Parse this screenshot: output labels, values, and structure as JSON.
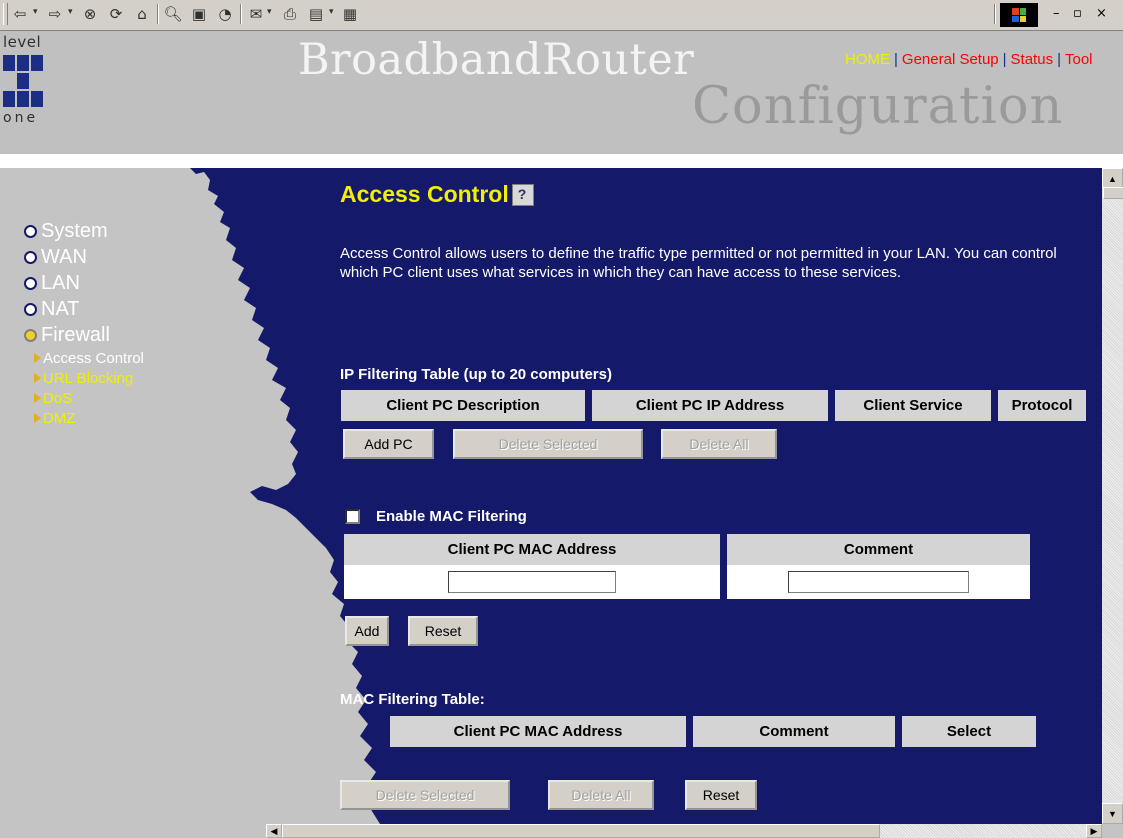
{
  "toolbar": {
    "back_icon": "back-arrow-icon",
    "forward_icon": "forward-arrow-icon",
    "icons": [
      "stop-icon",
      "refresh-icon",
      "home-icon",
      "search-icon",
      "favorites-icon",
      "history-icon",
      "mail-icon",
      "print-icon",
      "edit-icon",
      "discuss-icon"
    ],
    "window_controls": [
      "–",
      "▫",
      "×"
    ]
  },
  "header": {
    "logo_top": "level",
    "logo_bottom": "one",
    "brand": "BroadbandRouter",
    "subtitle": "Configuration",
    "nav": {
      "home": "HOME",
      "general_setup": "General Setup",
      "status": "Status",
      "tools": "Tool",
      "separator": "|"
    }
  },
  "menu": {
    "items": [
      {
        "label": "System",
        "selected": false
      },
      {
        "label": "WAN",
        "selected": false
      },
      {
        "label": "LAN",
        "selected": false
      },
      {
        "label": "NAT",
        "selected": false
      },
      {
        "label": "Firewall",
        "selected": true
      }
    ],
    "firewall_sub": [
      {
        "label": "Access Control",
        "active": true
      },
      {
        "label": "URL Blocking",
        "active": false
      },
      {
        "label": "DoS",
        "active": false
      },
      {
        "label": "DMZ",
        "active": false
      }
    ]
  },
  "page": {
    "title": "Access Control",
    "description": "Access Control allows users to define the traffic type permitted or not permitted in your LAN. You can control which PC client uses what services in which they can have access to these services."
  },
  "ip_table": {
    "title": "IP Filtering Table (up to 20 computers)",
    "columns": [
      "Client PC Description",
      "Client PC IP Address",
      "Client Service",
      "Protocol"
    ],
    "buttons": {
      "add": "Add PC",
      "delete_selected": "Delete Selected",
      "delete_all": "Delete All"
    }
  },
  "mac_filter": {
    "enable_label": "Enable MAC Filtering",
    "enabled": false,
    "columns": [
      "Client PC MAC Address",
      "Comment"
    ],
    "mac_value": "",
    "comment_value": "",
    "buttons": {
      "add": "Add",
      "reset": "Reset"
    }
  },
  "mac_table": {
    "title": "MAC Filtering Table:",
    "columns": [
      "Client PC MAC Address",
      "Comment",
      "Select"
    ],
    "buttons": {
      "delete_selected": "Delete Selected",
      "delete_all": "Delete All",
      "reset": "Reset"
    }
  },
  "colors": {
    "accent_blue": "#15196a",
    "highlight_yellow": "#f0f000",
    "link_red": "#ff0000",
    "panel_gray": "#c4c4c4"
  }
}
